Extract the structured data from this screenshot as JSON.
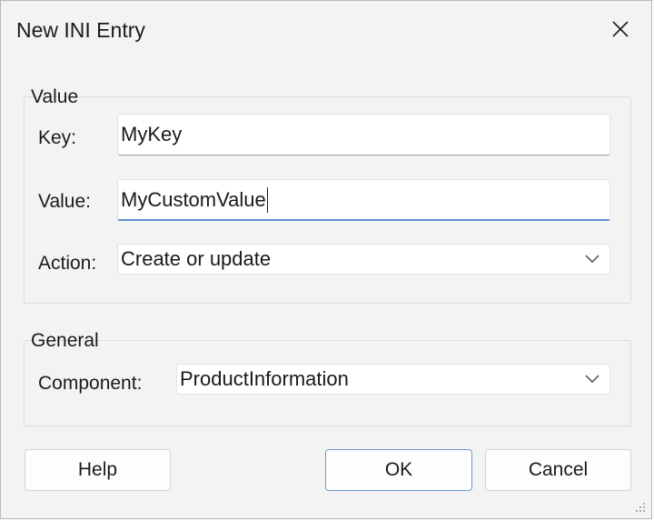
{
  "window": {
    "title": "New INI Entry"
  },
  "value_group": {
    "label": "Value",
    "key_label": "Key:",
    "key_value": "MyKey",
    "value_label": "Value:",
    "value_value": "MyCustomValue",
    "action_label": "Action:",
    "action_selected": "Create or update"
  },
  "general_group": {
    "label": "General",
    "component_label": "Component:",
    "component_selected": "ProductInformation"
  },
  "buttons": {
    "help": "Help",
    "ok": "OK",
    "cancel": "Cancel"
  },
  "icons": {
    "close": "close-icon",
    "chevron": "chevron-down-icon",
    "grip": "resize-grip-icon"
  },
  "colors": {
    "window_bg": "#f3f3f3",
    "focus_accent": "#5b8fd0",
    "default_button_border": "#6c9bd4"
  }
}
